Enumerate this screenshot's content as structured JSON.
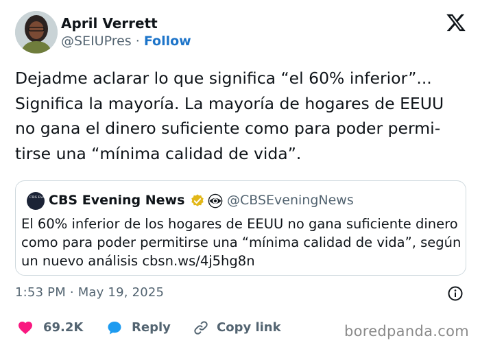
{
  "author": {
    "name": "April Verrett",
    "handle": "@SEIUPres",
    "separator": "·",
    "follow_label": "Follow"
  },
  "tweet": {
    "text": "Dejadme aclarar lo que significa “el 60% inferior”... Significa la mayoría. La mayoría de hogares de EEUU no gana el dinero suficiente como para poder permi-tirse una “mínima calidad de vida”."
  },
  "quote": {
    "avatar_text": "CBS Evening News",
    "name": "CBS Evening News",
    "handle": "@CBSEveningNews",
    "text": "El 60% inferior de los hogares de EEUU no gana suficiente dinero como para poder permitirse una “mínima calidad de vida”, según un nuevo análisis cbsn.ws/4j5hg8n"
  },
  "timestamp": "1:53 PM · May 19, 2025",
  "actions": {
    "likes": "69.2K",
    "reply_label": "Reply",
    "copy_label": "Copy link"
  },
  "watermark": "boredpanda.com",
  "icons": {
    "x_logo": "x-logo-icon",
    "verified": "verified-badge-icon",
    "cbs": "cbs-eye-icon",
    "info": "info-icon",
    "like": "heart-icon",
    "reply": "speech-bubble-icon",
    "copy": "link-icon"
  },
  "colors": {
    "link": "#1d74c9",
    "like": "#f91880",
    "reply": "#1d9bf0",
    "verified": "#e2b719",
    "muted": "#536471"
  }
}
